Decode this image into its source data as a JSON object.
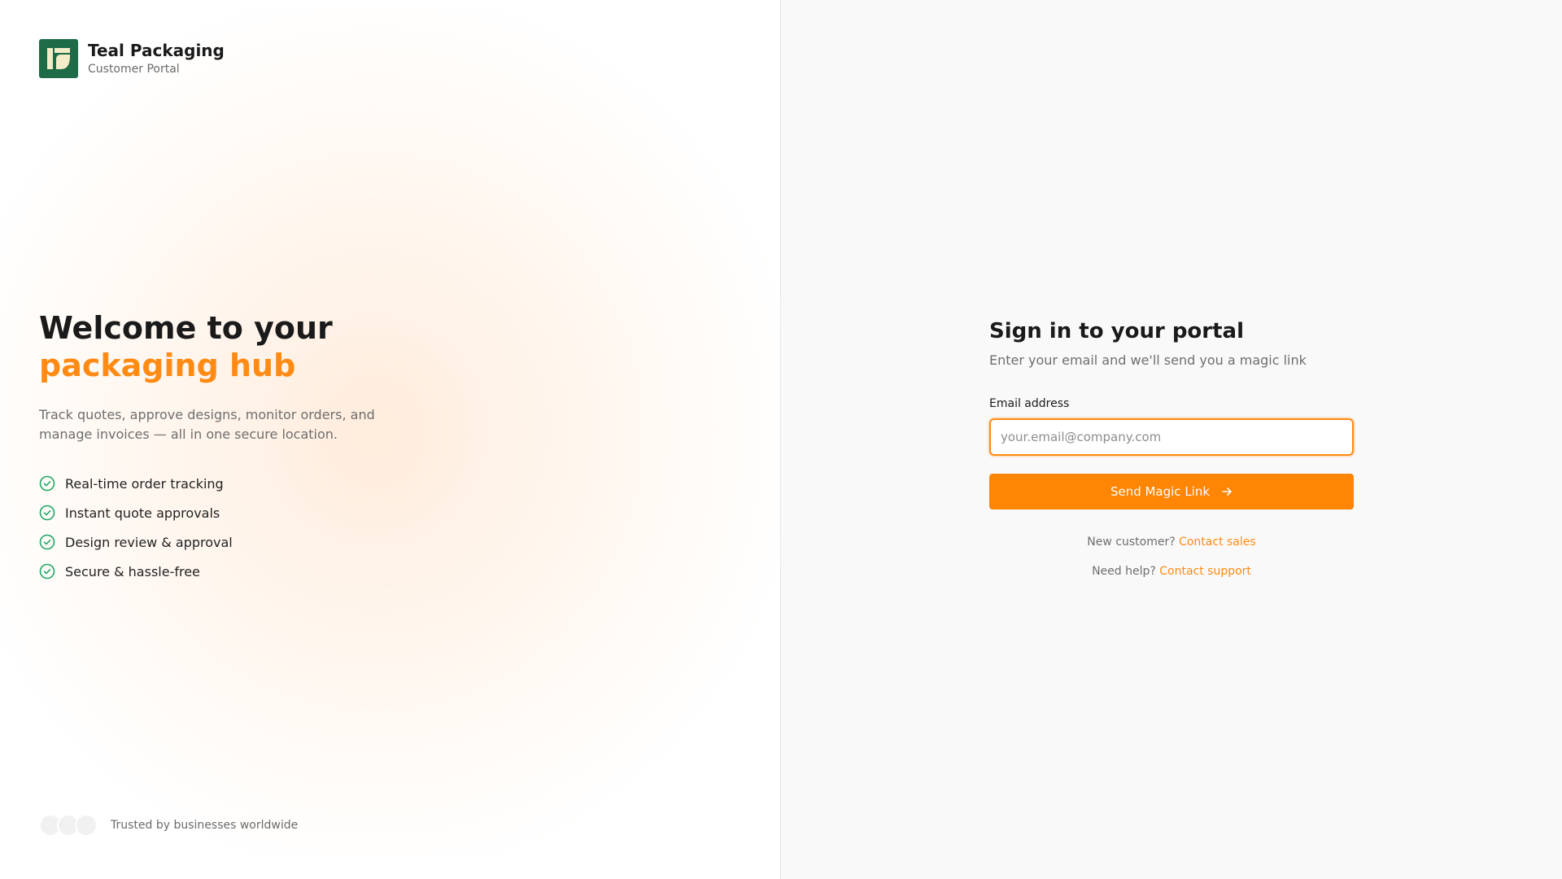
{
  "brand": {
    "name": "Teal Packaging",
    "subtitle": "Customer Portal"
  },
  "hero": {
    "title_line1": "Welcome to your",
    "title_line2": "packaging hub",
    "description": "Track quotes, approve designs, monitor orders, and manage invoices — all in one secure location."
  },
  "features": [
    {
      "label": "Real-time order tracking",
      "icon": "check-circle-icon"
    },
    {
      "label": "Instant quote approvals",
      "icon": "check-circle-icon"
    },
    {
      "label": "Design review & approval",
      "icon": "check-circle-icon"
    },
    {
      "label": "Secure & hassle-free",
      "icon": "check-circle-icon"
    }
  ],
  "trust": {
    "text": "Trusted by businesses worldwide"
  },
  "login": {
    "title": "Sign in to your portal",
    "subtitle": "Enter your email and we'll send you a magic link",
    "email_label": "Email address",
    "email_value": "",
    "email_placeholder": "your.email@company.com",
    "submit_label": "Send Magic Link",
    "new_customer_text": "New customer?",
    "new_customer_link": "Contact sales",
    "help_text": "Need help?",
    "help_link": "Contact support"
  },
  "colors": {
    "accent": "#ff8505",
    "brand_green": "#1d6b47",
    "check_green": "#22a565"
  }
}
